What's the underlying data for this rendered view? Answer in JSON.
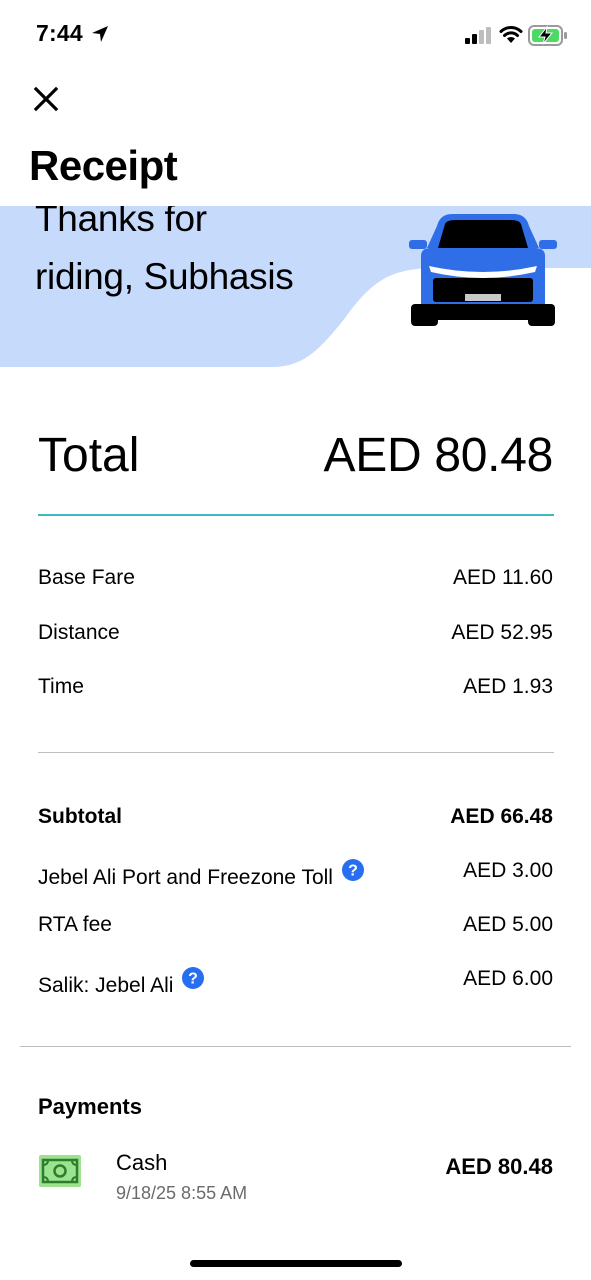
{
  "status_bar": {
    "time": "7:44"
  },
  "header": {
    "title": "Receipt"
  },
  "hero": {
    "line1": "Thanks for",
    "line2": "riding, Subhasis",
    "background_color": "#c6dafc",
    "car_color": "#2f6ee6"
  },
  "total": {
    "label": "Total",
    "value": "AED 80.48",
    "divider_color": "#3fb7c4"
  },
  "fare_items": [
    {
      "label": "Base Fare",
      "value": "AED 11.60"
    },
    {
      "label": "Distance",
      "value": "AED 52.95"
    },
    {
      "label": "Time",
      "value": "AED 1.93"
    }
  ],
  "subtotal": {
    "label": "Subtotal",
    "value": "AED 66.48"
  },
  "fees": [
    {
      "label": "Jebel Ali Port and Freezone Toll",
      "value": "AED 3.00",
      "has_help": true
    },
    {
      "label": "RTA fee",
      "value": "AED 5.00",
      "has_help": false
    },
    {
      "label": "Salik: Jebel Ali",
      "value": "AED 6.00",
      "has_help": true
    }
  ],
  "payments": {
    "heading": "Payments",
    "method": "Cash",
    "date": "9/18/25 8:55 AM",
    "amount": "AED 80.48",
    "icon": "cash-icon",
    "help_icon_color": "#276ef1"
  }
}
